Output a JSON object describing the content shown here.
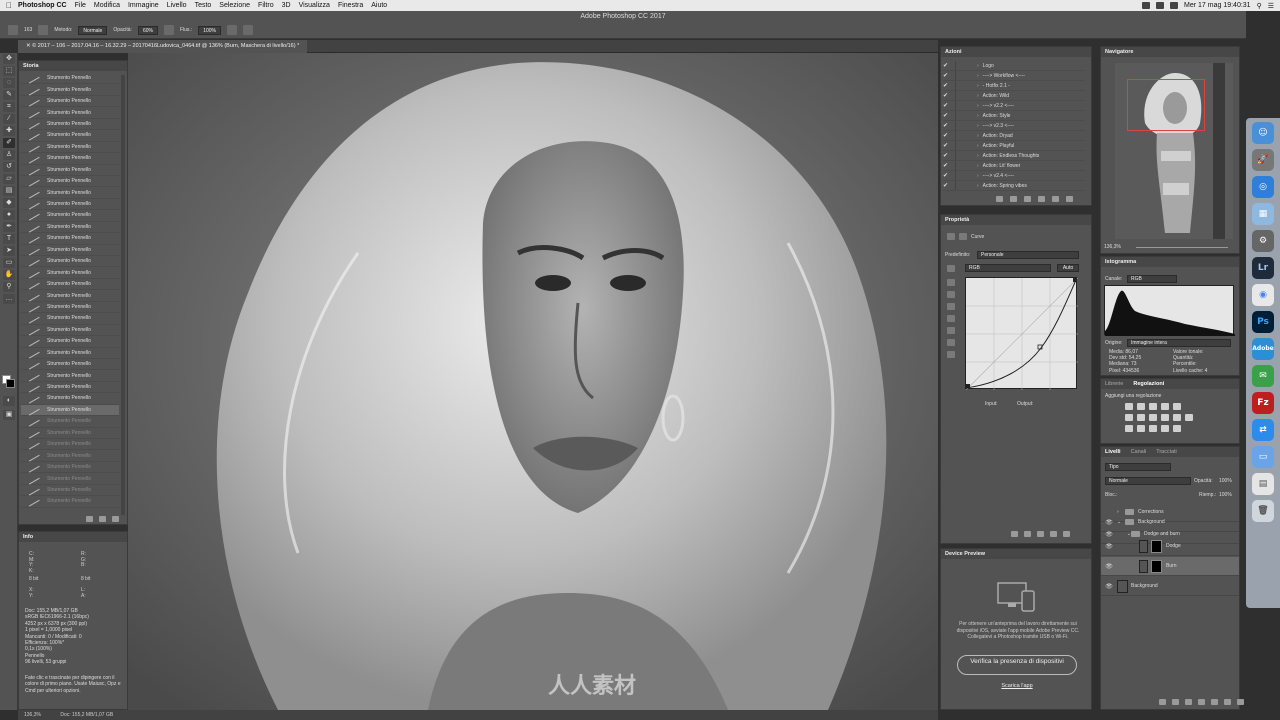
{
  "menubar": {
    "app": "Photoshop CC",
    "items": [
      "File",
      "Modifica",
      "Immagine",
      "Livello",
      "Testo",
      "Selezione",
      "Filtro",
      "3D",
      "Visualizza",
      "Finestra",
      "Aiuto"
    ],
    "clock": "Mer 17 mag  19:40:31"
  },
  "window_title": "Adobe Photoshop CC 2017",
  "options": {
    "mode_label": "Metodo:",
    "mode_value": "Normale",
    "opacity_label": "Opacità:",
    "opacity_value": "60%",
    "flow_label": "Flus.:",
    "flow_value": "100%",
    "brush_size": "163"
  },
  "document_tab": "© 2017 – 106 – 2017.04.16 – 16.32.29 – 20170416Ludovica_0464.tif @ 136% (Burn, Maschera di livello/16) *",
  "history": {
    "title": "Storia",
    "item_label": "Strumento Pennello",
    "items_active": 30,
    "items_future": 8
  },
  "info": {
    "title": "Info",
    "c_label": "C:",
    "m_label": "M:",
    "y_label": "Y:",
    "k_label": "K:",
    "r_label": "R:",
    "g_label": "G:",
    "b_label": "B:",
    "bit_left": "8 bit",
    "bit_right": "8 bit",
    "x_label": "X:",
    "y2_label": "Y:",
    "w_label": "L:",
    "h_label": "A:",
    "lines": [
      "Doc: 155,2 MB/1,07 GB",
      "sRGB IEC61966-2.1 (16bpc)",
      "4252 px x 6378 px (300 ppi)",
      "1 pixel = 1,0000 pixel",
      "Mancanti: 0 / Modificati: 0",
      "Efficienza: 100%*",
      "0,1s (100%)",
      "Pennello",
      "96 livelli, 53 gruppi"
    ],
    "hint": "Fate clic e trascinate per dipingere con il colore di primo piano. Usate Maiusc, Opz e Cmd per ulteriori opzioni."
  },
  "statusbar": {
    "zoom": "136,3%",
    "doc": "Doc: 155,2 MB/1,07 GB"
  },
  "watermark": "人人素材",
  "actions": {
    "title": "Azioni",
    "items": [
      "Logo",
      "----> Workflow <----",
      "- Hotfix 2.1 -",
      "Action: Wild",
      "----> v2.2 <----",
      "Action: Style",
      "----> v2.3 <----",
      "Action: Dryad",
      "Action: Playful",
      "Action: Endless Thoughts",
      "Action: Lit' flower",
      "----> v2.4 <----",
      "Action: Spring vibes"
    ]
  },
  "properties": {
    "title": "Proprietà",
    "type": "Curve",
    "preset_label": "Predefinito:",
    "preset_value": "Personale",
    "channel": "RGB",
    "auto": "Auto",
    "input_label": "Input:",
    "output_label": "Output:"
  },
  "device_preview": {
    "title": "Device Preview",
    "text": "Per ottenere un'anteprima del lavoro direttamente sui dispositivi iOS, avviate l'app mobile Adobe Preview CC. Collegatevi a Photoshop tramite USB o Wi-Fi.",
    "button": "Verifica la presenza di dispositivi",
    "link": "Scarica l'app"
  },
  "navigator": {
    "title": "Navigatore",
    "zoom": "136,3%"
  },
  "histogram": {
    "title": "Istogramma",
    "channel_label": "Canale:",
    "channel_value": "RGB",
    "source_label": "Origine:",
    "source_value": "Immagine intera",
    "stats_left": [
      "Media:  86,07",
      "Dev std:  54,25",
      "Mediana:  73",
      "Pixel:  434536"
    ],
    "stats_right": [
      "Valore tonale:",
      "Quantità:",
      "Percentile:",
      "Livello cache:  4"
    ]
  },
  "adjustments": {
    "tab_libraries": "Librerie",
    "tab_adjust": "Regolazioni",
    "hint": "Aggiungi una regolazione"
  },
  "layers": {
    "tabs": [
      "Livelli",
      "Canali",
      "Tracciati"
    ],
    "filter": "Tipo",
    "blend": "Normale",
    "opacity_label": "Opacità:",
    "opacity_value": "100%",
    "lock_label": "Bloc.:",
    "fill_label": "Riemp.:",
    "fill_value": "100%",
    "rows": [
      "Corrections",
      "Background",
      "Dodge and burn",
      "Dodge",
      "Burn",
      "Background"
    ]
  },
  "dock": {
    "items": [
      "Finder",
      "Launchpad",
      "Safari",
      "Preview",
      "System Preferences",
      "Lr",
      "Chrome",
      "Ps",
      "Adobe",
      "Mail",
      "FileZilla",
      "TeamViewer",
      "Folder",
      "Document",
      "Trash"
    ]
  }
}
